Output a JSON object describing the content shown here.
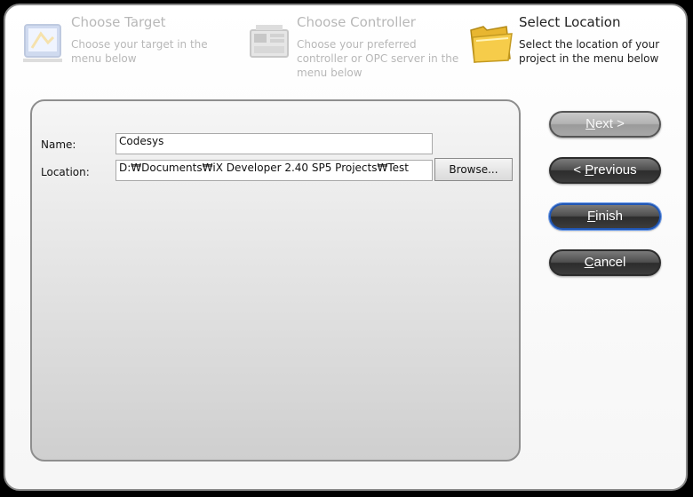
{
  "steps": [
    {
      "title": "Choose Target",
      "description": "Choose your target in the menu below",
      "icon": "target-icon",
      "active": false
    },
    {
      "title": "Choose Controller",
      "description": "Choose your preferred controller or OPC server in the menu below",
      "icon": "controller-icon",
      "active": false
    },
    {
      "title": "Select Location",
      "description": "Select the location of your project in the menu below",
      "icon": "folder-icon",
      "active": true
    }
  ],
  "form": {
    "name_label": "Name:",
    "name_value": "Codesys",
    "location_label": "Location:",
    "location_value": "D:₩Documents₩iX Developer 2.40 SP5 Projects₩Test",
    "browse_label": "Browse..."
  },
  "buttons": {
    "next": {
      "mnemonic": "N",
      "rest": "ext >"
    },
    "previous": {
      "prefix": "< ",
      "mnemonic": "P",
      "rest": "revious"
    },
    "finish": {
      "mnemonic": "F",
      "rest": "inish"
    },
    "cancel": {
      "mnemonic": "C",
      "rest": "ancel"
    }
  },
  "colors": {
    "focus_border": "#1f56b5",
    "dark_button": "#3c3c3c",
    "panel_border": "#8e8e8e"
  }
}
